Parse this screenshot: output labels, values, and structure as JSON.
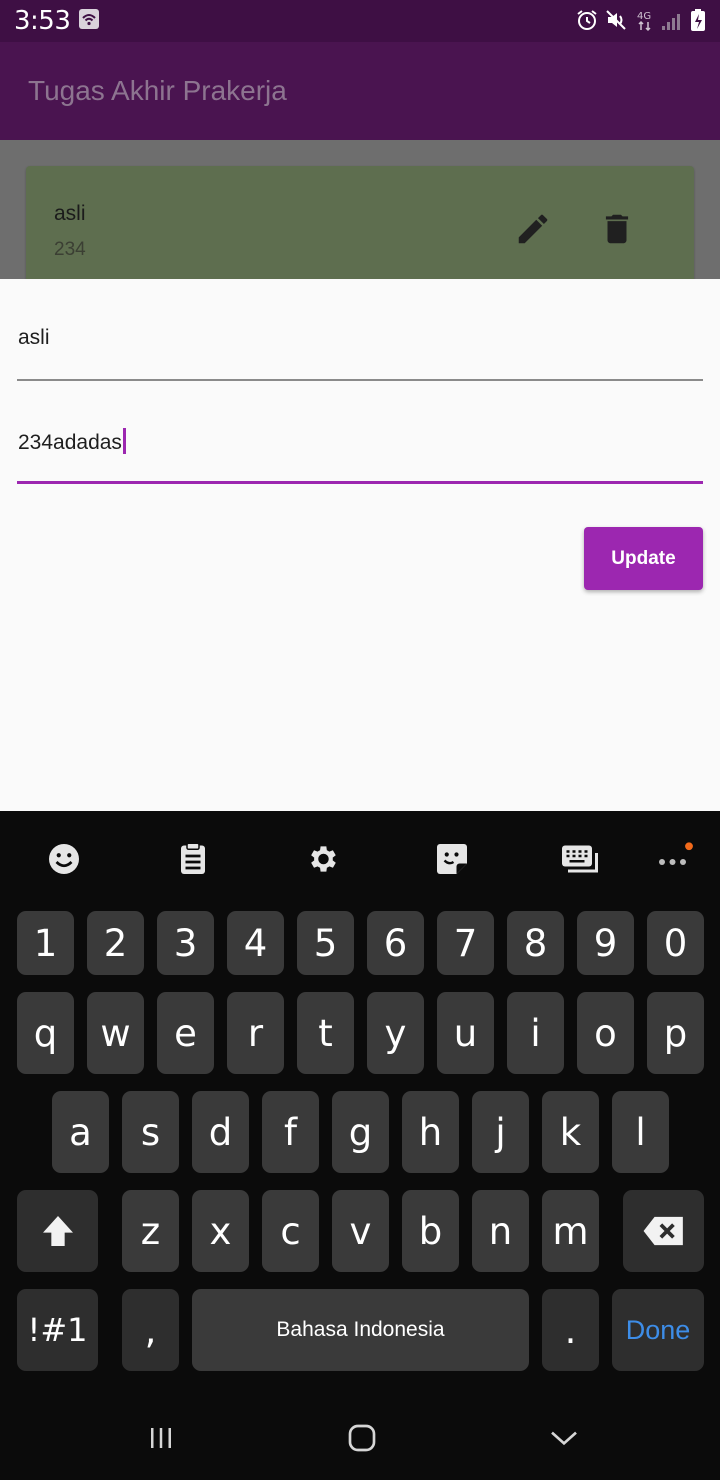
{
  "status_bar": {
    "time": "3:53",
    "icons": [
      "wifi-icon",
      "alarm-icon",
      "mute-icon",
      "4g-icon",
      "signal-icon",
      "battery-icon"
    ]
  },
  "app_bar": {
    "title": "Tugas Akhir Prakerja"
  },
  "list": {
    "items": [
      {
        "title": "asli",
        "subtitle": "234",
        "actions": [
          "edit-icon",
          "delete-icon"
        ]
      }
    ]
  },
  "form": {
    "title_field": {
      "value": "asli"
    },
    "desc_field": {
      "value": "234adadas"
    },
    "submit_label": "Update"
  },
  "keyboard": {
    "toolbar": [
      "emoji-icon",
      "clipboard-icon",
      "settings-icon",
      "sticker-icon",
      "keyboard-icon",
      "more-icon"
    ],
    "row_numbers": [
      "1",
      "2",
      "3",
      "4",
      "5",
      "6",
      "7",
      "8",
      "9",
      "0"
    ],
    "row_1": [
      "q",
      "w",
      "e",
      "r",
      "t",
      "y",
      "u",
      "i",
      "o",
      "p"
    ],
    "row_2": [
      "a",
      "s",
      "d",
      "f",
      "g",
      "h",
      "j",
      "k",
      "l"
    ],
    "row_3": [
      "z",
      "x",
      "c",
      "v",
      "b",
      "n",
      "m"
    ],
    "symbols_label": "!#1",
    "comma_label": ",",
    "space_label": "Bahasa Indonesia",
    "period_label": ".",
    "done_label": "Done"
  },
  "colors": {
    "accent": "#9c27b0",
    "app_bar": "#4a1450",
    "status_bar": "#3e0f44",
    "card": "#5e6e4f",
    "done_text": "#3d8de8"
  }
}
